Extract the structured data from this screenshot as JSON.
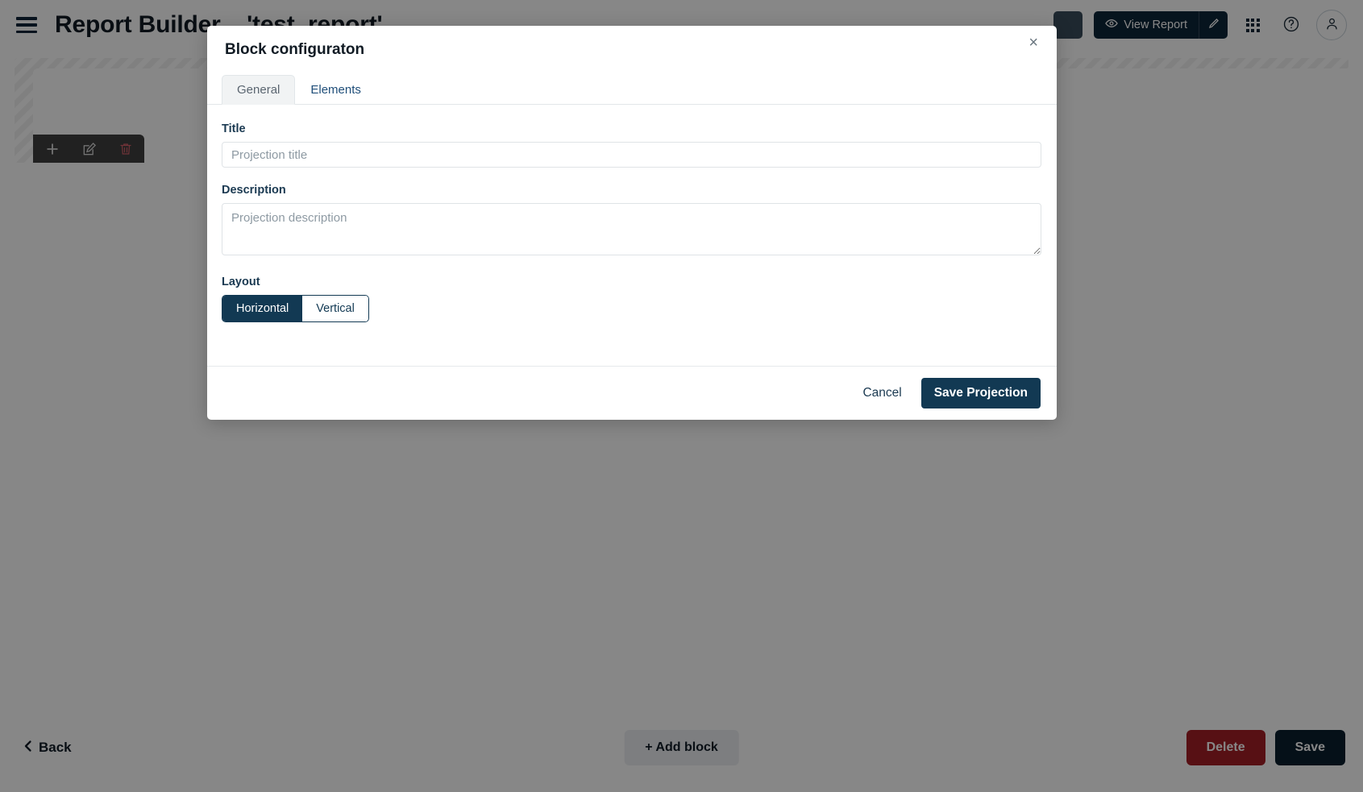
{
  "navbar": {
    "menu_icon": "hamburger-menu-icon",
    "app_title": "Report Builder",
    "report_name": "'test_report'",
    "secondary_button_label": "",
    "view_report_label": "View Report",
    "view_report_icon": "eye-icon",
    "edit_icon": "pencil-icon",
    "apps_icon": "apps-grid-icon",
    "help_icon": "question-mark-circle-icon",
    "avatar_icon": "user-avatar-icon"
  },
  "canvas": {
    "block_toolbar": {
      "add_icon": "plus-icon",
      "edit_icon": "pencil-square-icon",
      "delete_icon": "trash-icon"
    }
  },
  "bottom_bar": {
    "back_label": "Back",
    "back_icon": "chevron-left-icon",
    "add_block_label": "+ Add block",
    "delete_label": "Delete",
    "save_label": "Save",
    "delete_color": "#a51f26",
    "save_color": "#0b1f2e"
  },
  "modal": {
    "title": "Block configuraton",
    "close_label": "×",
    "close_icon": "close-icon",
    "tabs": [
      {
        "label": "General",
        "active": true
      },
      {
        "label": "Elements",
        "active": false
      }
    ],
    "fields": {
      "title": {
        "label": "Title",
        "placeholder": "Projection title",
        "value": ""
      },
      "description": {
        "label": "Description",
        "placeholder": "Projection description",
        "value": ""
      },
      "layout": {
        "label": "Layout",
        "options": [
          "Horizontal",
          "Vertical"
        ],
        "selected": "Horizontal",
        "selected_color": "#123953"
      }
    },
    "footer": {
      "cancel_label": "Cancel",
      "save_label": "Save Projection",
      "save_color": "#123953"
    }
  }
}
